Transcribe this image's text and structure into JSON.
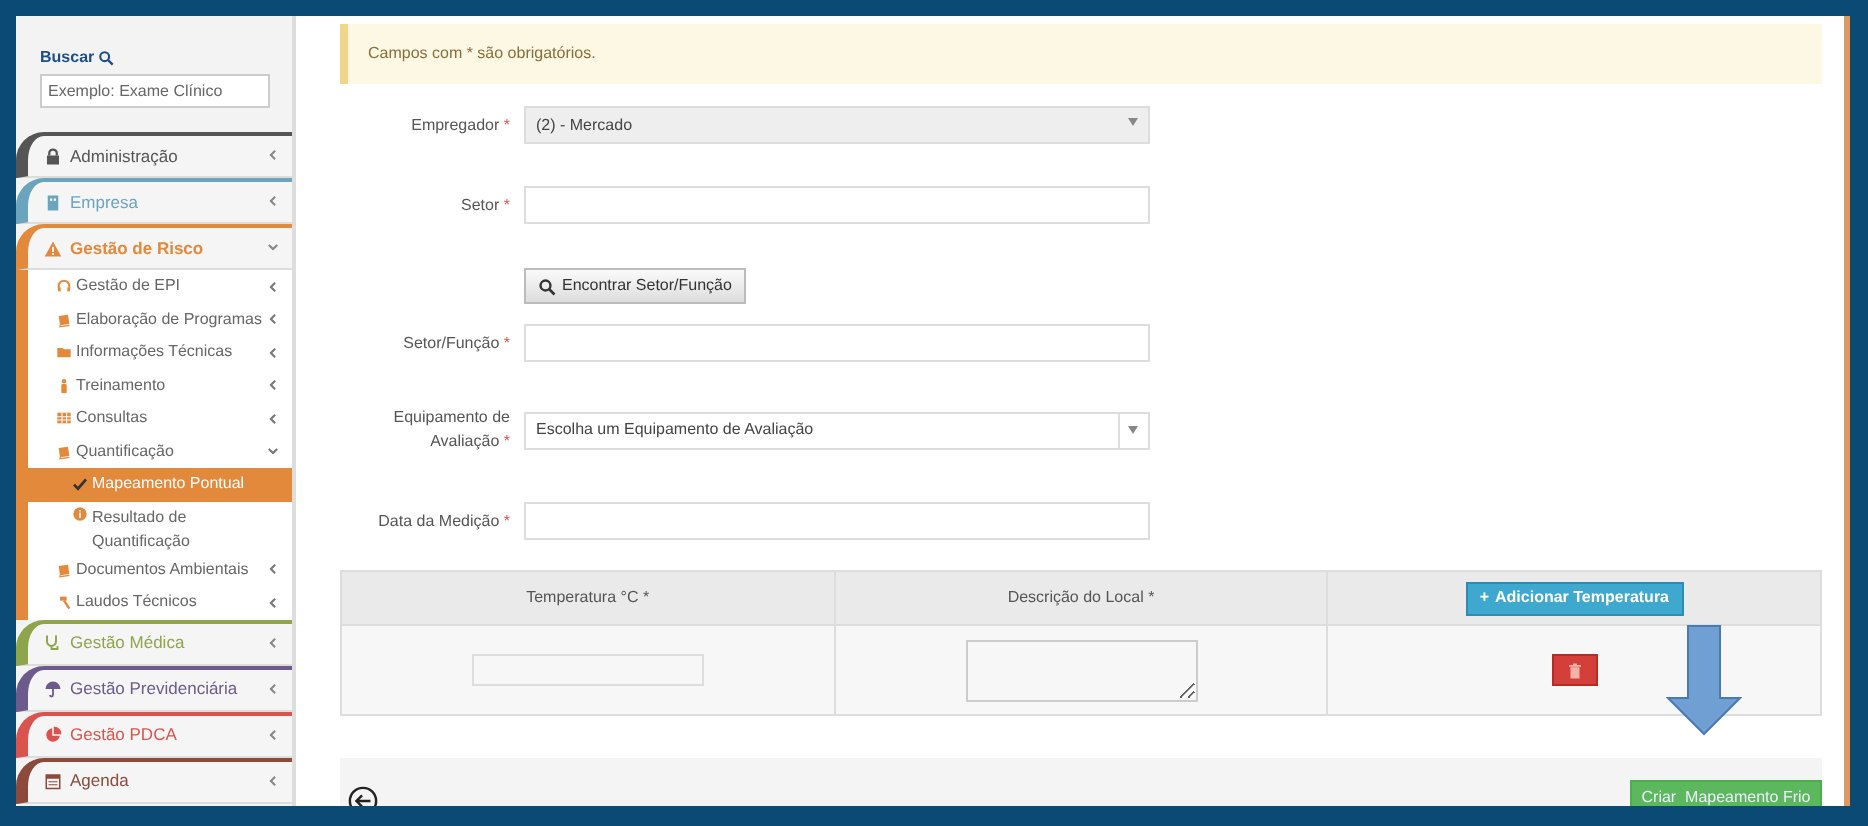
{
  "sidebar": {
    "search": {
      "label": "Buscar",
      "placeholder": "Exemplo: Exame Clínico"
    },
    "menu": [
      {
        "label": "Administração",
        "color": "#555555",
        "expanded": false
      },
      {
        "label": "Empresa",
        "color": "#6aa5bd",
        "expanded": false
      },
      {
        "label": "Gestão de Risco",
        "color": "#e2893b",
        "expanded": true,
        "children": [
          {
            "label": "Gestão de EPI",
            "expanded": false,
            "selected": false
          },
          {
            "label": "Elaboração de Programas",
            "expanded": false,
            "selected": false
          },
          {
            "label": "Informações Técnicas",
            "expanded": false,
            "selected": false
          },
          {
            "label": "Treinamento",
            "expanded": false,
            "selected": false
          },
          {
            "label": "Consultas",
            "expanded": false,
            "selected": false
          },
          {
            "label": "Quantificação",
            "expanded": true,
            "selected": false,
            "children": [
              {
                "label": "Mapeamento Pontual",
                "selected": true
              },
              {
                "label": "Resultado de Quantificação",
                "selected": false
              }
            ]
          },
          {
            "label": "Documentos Ambientais",
            "expanded": false,
            "selected": false
          },
          {
            "label": "Laudos Técnicos",
            "expanded": false,
            "selected": false
          }
        ]
      },
      {
        "label": "Gestão Médica",
        "color": "#8ea54c",
        "expanded": false
      },
      {
        "label": "Gestão Previdenciária",
        "color": "#6d5a8c",
        "expanded": false
      },
      {
        "label": "Gestão PDCA",
        "color": "#d9534f",
        "expanded": false
      },
      {
        "label": "Agenda",
        "color": "#8b4a3b",
        "expanded": false
      }
    ]
  },
  "alert": "Campos com * são obrigatórios.",
  "form": [
    {
      "kind": "select",
      "label": "Empregador",
      "mark": "*",
      "value": "(2) - Mercado",
      "disabled": true
    },
    {
      "kind": "input",
      "label": "Setor",
      "mark": "*"
    },
    {
      "kind": "button",
      "label": "Encontrar Setor/Função"
    },
    {
      "kind": "input",
      "label": "Setor/Função",
      "mark": "*"
    },
    {
      "kind": "select",
      "label": "Equipamento de Avaliação",
      "mark": "*",
      "placeholder": "Escolha um Equipamento de Avaliação",
      "disabled": false
    },
    {
      "kind": "input",
      "label": "Data da Medição",
      "mark": "*"
    }
  ],
  "table": {
    "columns": [
      "Temperatura °C *",
      "Descrição do Local *"
    ],
    "add_button": {
      "icon": "+",
      "label": "Adicionar Temperatura"
    }
  },
  "footer": {
    "submit": "Criar  Mapeamento Frio"
  }
}
